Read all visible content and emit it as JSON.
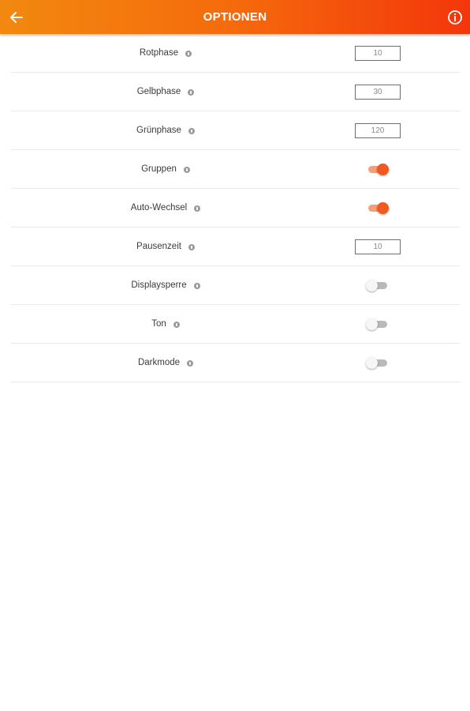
{
  "header": {
    "title": "OPTIONEN",
    "back_icon": "arrow-left-icon",
    "info_icon": "info-circle-icon",
    "gradient_start": "#f2890f",
    "gradient_end": "#f4360b"
  },
  "settings": [
    {
      "label": "Rotphase",
      "type": "number",
      "value": "10"
    },
    {
      "label": "Gelbphase",
      "type": "number",
      "value": "30"
    },
    {
      "label": "Grünphase",
      "type": "number",
      "value": "120"
    },
    {
      "label": "Gruppen",
      "type": "toggle",
      "checked": true
    },
    {
      "label": "Auto-Wechsel",
      "type": "toggle",
      "checked": true
    },
    {
      "label": "Pausenzeit",
      "type": "number",
      "value": "10"
    },
    {
      "label": "Displaysperre",
      "type": "toggle",
      "checked": false
    },
    {
      "label": "Ton",
      "type": "toggle",
      "checked": false
    },
    {
      "label": "Darkmode",
      "type": "toggle",
      "checked": false
    }
  ],
  "colors": {
    "accent": "#f05a22",
    "toggle_track_on": "#f0a07a",
    "toggle_track_off": "#b9b9b9"
  }
}
